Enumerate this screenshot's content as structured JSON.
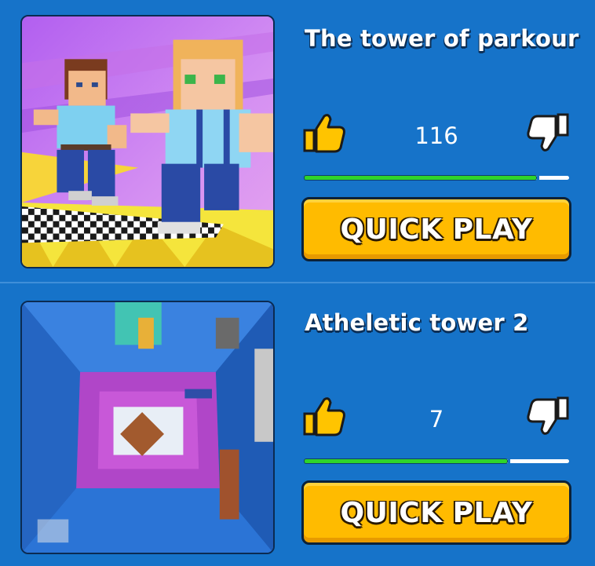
{
  "games": [
    {
      "title": "The tower of parkour",
      "likes": "116",
      "rating_fraction": 0.88,
      "play_label": "QUICK PLAY",
      "thumbnail_icon": "parkour-characters-thumbnail"
    },
    {
      "title": "Atheletic tower 2",
      "likes": "7",
      "rating_fraction": 0.77,
      "play_label": "QUICK PLAY",
      "thumbnail_icon": "tower-interior-thumbnail"
    }
  ],
  "icons": {
    "like": "thumbs-up-icon",
    "dislike": "thumbs-down-icon"
  },
  "colors": {
    "background": "#1673c9",
    "button": "#ffbb00",
    "rating_fill": "#2fd42a",
    "like_icon": "#ffc400"
  }
}
